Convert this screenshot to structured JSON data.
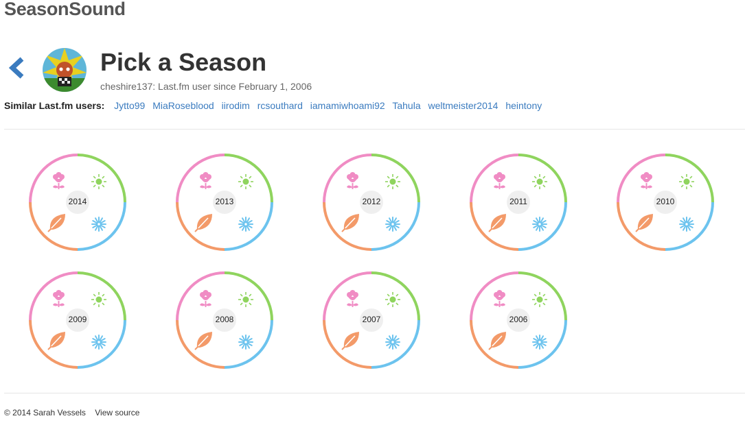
{
  "app": {
    "brand": "SeasonSound"
  },
  "header": {
    "title": "Pick a Season",
    "subtitle": "cheshire137: Last.fm user since February 1, 2006"
  },
  "similar": {
    "label": "Similar Last.fm users:",
    "users": [
      "Jytto99",
      "MiaRoseblood",
      "iirodim",
      "rcsouthard",
      "iamamiwhoami92",
      "Tahula",
      "weltmeister2014",
      "heintony"
    ]
  },
  "years": [
    "2014",
    "2013",
    "2012",
    "2011",
    "2010",
    "2009",
    "2008",
    "2007",
    "2006"
  ],
  "season_icons": [
    "spring-flower-icon",
    "summer-sun-icon",
    "autumn-leaf-icon",
    "winter-snowflake-icon"
  ],
  "colors": {
    "spring": "#f08cc4",
    "summer": "#8fd45e",
    "winter": "#6cc3ee",
    "autumn": "#f39a69",
    "link": "#3a7bbf",
    "back": "#3a7bbf"
  },
  "footer": {
    "copyright": "© 2014 Sarah Vessels",
    "source_link": "View source"
  }
}
